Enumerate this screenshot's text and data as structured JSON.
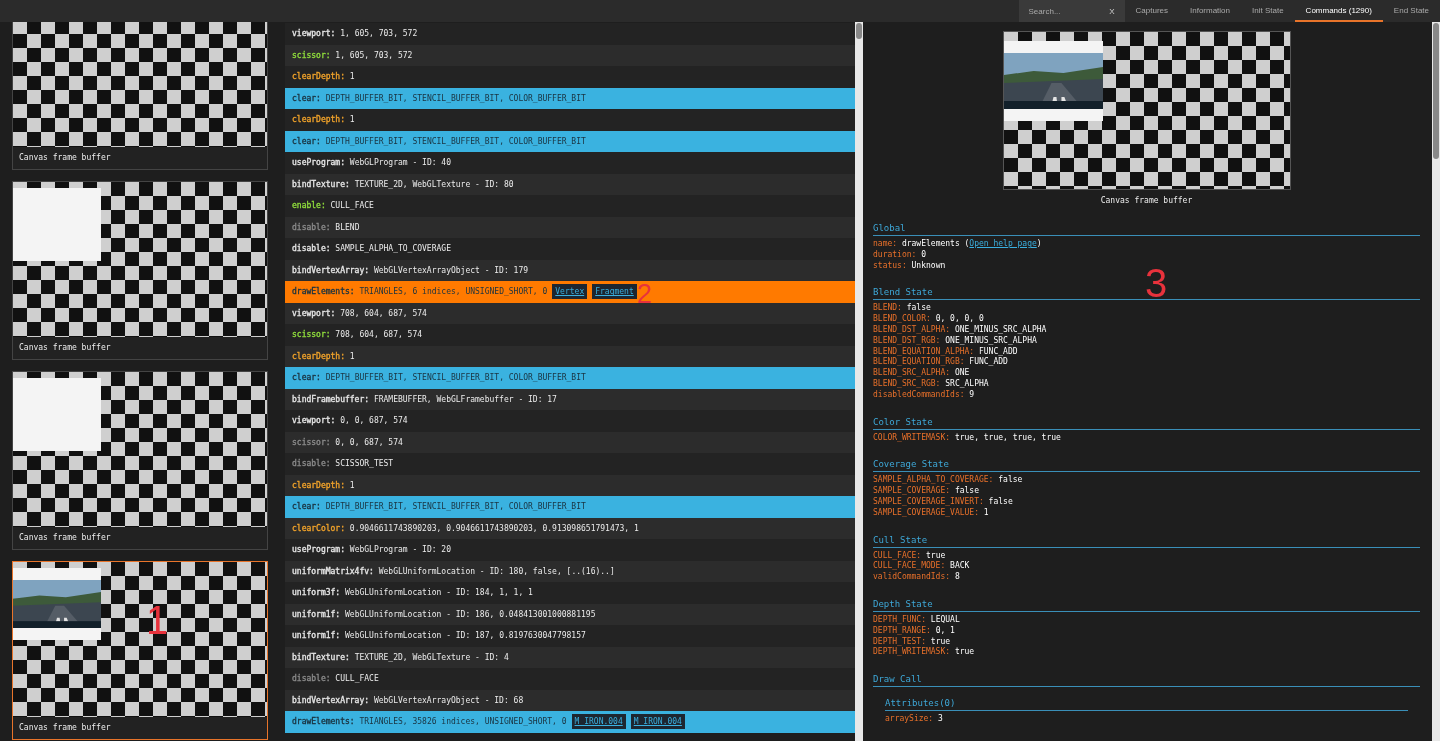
{
  "top_bar": {
    "search": {
      "placeholder": "Search...",
      "clear": "X"
    },
    "tabs": [
      {
        "label": "Captures",
        "selected": false
      },
      {
        "label": "Information",
        "selected": false
      },
      {
        "label": "Init State",
        "selected": false
      },
      {
        "label": "Commands (1290)",
        "selected": true
      },
      {
        "label": "End State",
        "selected": false
      }
    ]
  },
  "captures": [
    {
      "label": "Canvas frame buffer",
      "kind": "empty",
      "selected": false
    },
    {
      "label": "Canvas frame buffer",
      "kind": "white_block",
      "selected": false
    },
    {
      "label": "Canvas frame buffer",
      "kind": "white_block",
      "selected": false
    },
    {
      "label": "Canvas frame buffer",
      "selected": true
    }
  ],
  "commands": [
    {
      "name": "viewport:",
      "args": "1, 605, 703, 572",
      "kind": "plain",
      "color": "#e6e6e6",
      "selected": false
    },
    {
      "name": "scissor:",
      "args": "1, 605, 703, 572",
      "kind": "plain",
      "color": "#8fdc3c",
      "selected": false
    },
    {
      "name": "clearDepth:",
      "args": "1",
      "kind": "plain",
      "color": "#f0a22a",
      "selected": false
    },
    {
      "name": "clear:",
      "args": "DEPTH_BUFFER_BIT, STENCIL_BUFFER_BIT, COLOR_BUFFER_BIT",
      "kind": "draw",
      "selected": false
    },
    {
      "name": "clearDepth:",
      "args": "1",
      "kind": "plain",
      "color": "#f0a22a",
      "selected": false
    },
    {
      "name": "clear:",
      "args": "DEPTH_BUFFER_BIT, STENCIL_BUFFER_BIT, COLOR_BUFFER_BIT",
      "kind": "draw",
      "selected": false
    },
    {
      "name": "useProgram:",
      "args": "WebGLProgram - ID: 40",
      "kind": "plain",
      "color": "#e6e6e6",
      "selected": false
    },
    {
      "name": "bindTexture:",
      "args": "TEXTURE_2D, WebGLTexture - ID: 80",
      "kind": "plain",
      "color": "#e6e6e6",
      "selected": false
    },
    {
      "name": "enable:",
      "args": "CULL_FACE",
      "kind": "plain",
      "color": "#8fdc3c",
      "selected": false
    },
    {
      "name": "disable:",
      "args": "BLEND",
      "kind": "plain",
      "color": "#8a8a8a",
      "selected": false
    },
    {
      "name": "disable:",
      "args": "SAMPLE_ALPHA_TO_COVERAGE",
      "kind": "plain",
      "color": "#e6e6e6",
      "selected": false
    },
    {
      "name": "bindVertexArray:",
      "args": "WebGLVertexArrayObject - ID: 179",
      "kind": "plain",
      "color": "#e6e6e6",
      "selected": false
    },
    {
      "name": "drawElements:",
      "args": "TRIANGLES, 6 indices, UNSIGNED_SHORT, 0",
      "kind": "draw",
      "selected": true,
      "links": [
        "Vertex",
        "Fragment"
      ]
    },
    {
      "name": "viewport:",
      "args": "708, 604, 687, 574",
      "kind": "plain",
      "color": "#e6e6e6",
      "selected": false
    },
    {
      "name": "scissor:",
      "args": "708, 604, 687, 574",
      "kind": "plain",
      "color": "#8fdc3c",
      "selected": false
    },
    {
      "name": "clearDepth:",
      "args": "1",
      "kind": "plain",
      "color": "#f0a22a",
      "selected": false
    },
    {
      "name": "clear:",
      "args": "DEPTH_BUFFER_BIT, STENCIL_BUFFER_BIT, COLOR_BUFFER_BIT",
      "kind": "draw",
      "selected": false
    },
    {
      "name": "bindFramebuffer:",
      "args": "FRAMEBUFFER, WebGLFramebuffer - ID: 17",
      "kind": "plain",
      "color": "#e6e6e6",
      "selected": false
    },
    {
      "name": "viewport:",
      "args": "0, 0, 687, 574",
      "kind": "plain",
      "color": "#e6e6e6",
      "selected": false
    },
    {
      "name": "scissor:",
      "args": "0, 0, 687, 574",
      "kind": "plain",
      "color": "#8a8a8a",
      "selected": false
    },
    {
      "name": "disable:",
      "args": "SCISSOR_TEST",
      "kind": "plain",
      "color": "#8a8a8a",
      "selected": false
    },
    {
      "name": "clearDepth:",
      "args": "1",
      "kind": "plain",
      "color": "#f0a22a",
      "selected": false
    },
    {
      "name": "clear:",
      "args": "DEPTH_BUFFER_BIT, STENCIL_BUFFER_BIT, COLOR_BUFFER_BIT",
      "kind": "draw",
      "selected": false
    },
    {
      "name": "clearColor:",
      "args": "0.9046611743890203, 0.9046611743890203, 0.913098651791473, 1",
      "kind": "plain",
      "color": "#f0a22a",
      "selected": false
    },
    {
      "name": "useProgram:",
      "args": "WebGLProgram - ID: 20",
      "kind": "plain",
      "color": "#e6e6e6",
      "selected": false
    },
    {
      "name": "uniformMatrix4fv:",
      "args": "WebGLUniformLocation - ID: 180, false, [..(16)..]",
      "kind": "plain",
      "color": "#e6e6e6",
      "selected": false
    },
    {
      "name": "uniform3f:",
      "args": "WebGLUniformLocation - ID: 184, 1, 1, 1",
      "kind": "plain",
      "color": "#e6e6e6",
      "selected": false
    },
    {
      "name": "uniform1f:",
      "args": "WebGLUniformLocation - ID: 186, 0.048413001000881195",
      "kind": "plain",
      "color": "#e6e6e6",
      "selected": false
    },
    {
      "name": "uniform1f:",
      "args": "WebGLUniformLocation - ID: 187, 0.8197630047798157",
      "kind": "plain",
      "color": "#e6e6e6",
      "selected": false
    },
    {
      "name": "bindTexture:",
      "args": "TEXTURE_2D, WebGLTexture - ID: 4",
      "kind": "plain",
      "color": "#e6e6e6",
      "selected": false
    },
    {
      "name": "disable:",
      "args": "CULL_FACE",
      "kind": "plain",
      "color": "#8a8a8a",
      "selected": false
    },
    {
      "name": "bindVertexArray:",
      "args": "WebGLVertexArrayObject - ID: 68",
      "kind": "plain",
      "color": "#e6e6e6",
      "selected": false
    },
    {
      "name": "drawElements:",
      "args": "TRIANGLES, 35826 indices, UNSIGNED_SHORT, 0",
      "kind": "draw",
      "selected": false,
      "links": [
        "M_IRON.004",
        "M_IRON.004"
      ]
    }
  ],
  "details": {
    "preview_label": "Canvas frame buffer",
    "sections": [
      {
        "title": "Global",
        "props": [
          {
            "key": "name:",
            "value": "drawElements (",
            "link": "Open help page",
            "after": ")"
          },
          {
            "key": "duration:",
            "value": "0"
          },
          {
            "key": "status:",
            "value": "Unknown"
          }
        ]
      },
      {
        "title": "Blend State",
        "props": [
          {
            "key": "BLEND:",
            "value": "false"
          },
          {
            "key": "BLEND_COLOR:",
            "value": "0, 0, 0, 0"
          },
          {
            "key": "BLEND_DST_ALPHA:",
            "value": "ONE_MINUS_SRC_ALPHA"
          },
          {
            "key": "BLEND_DST_RGB:",
            "value": "ONE_MINUS_SRC_ALPHA"
          },
          {
            "key": "BLEND_EQUATION_ALPHA:",
            "value": "FUNC_ADD"
          },
          {
            "key": "BLEND_EQUATION_RGB:",
            "value": "FUNC_ADD"
          },
          {
            "key": "BLEND_SRC_ALPHA:",
            "value": "ONE"
          },
          {
            "key": "BLEND_SRC_RGB:",
            "value": "SRC_ALPHA"
          },
          {
            "key": "disabledCommandIds:",
            "value": "9"
          }
        ]
      },
      {
        "title": "Color State",
        "props": [
          {
            "key": "COLOR_WRITEMASK:",
            "value": "true, true, true, true"
          }
        ]
      },
      {
        "title": "Coverage State",
        "props": [
          {
            "key": "SAMPLE_ALPHA_TO_COVERAGE:",
            "value": "false"
          },
          {
            "key": "SAMPLE_COVERAGE:",
            "value": "false"
          },
          {
            "key": "SAMPLE_COVERAGE_INVERT:",
            "value": "false"
          },
          {
            "key": "SAMPLE_COVERAGE_VALUE:",
            "value": "1"
          }
        ]
      },
      {
        "title": "Cull State",
        "props": [
          {
            "key": "CULL_FACE:",
            "value": "true"
          },
          {
            "key": "CULL_FACE_MODE:",
            "value": "BACK"
          },
          {
            "key": "validCommandIds:",
            "value": "8"
          }
        ]
      },
      {
        "title": "Depth State",
        "props": [
          {
            "key": "DEPTH_FUNC:",
            "value": "LEQUAL"
          },
          {
            "key": "DEPTH_RANGE:",
            "value": "0, 1"
          },
          {
            "key": "DEPTH_TEST:",
            "value": "true"
          },
          {
            "key": "DEPTH_WRITEMASK:",
            "value": "true"
          }
        ]
      },
      {
        "title": "Draw Call",
        "subsections": [
          {
            "title": "Attributes(0)",
            "props": [
              {
                "key": "arraySize:",
                "value": "3"
              }
            ]
          }
        ]
      }
    ]
  },
  "annotations": [
    "1",
    "2",
    "3"
  ]
}
